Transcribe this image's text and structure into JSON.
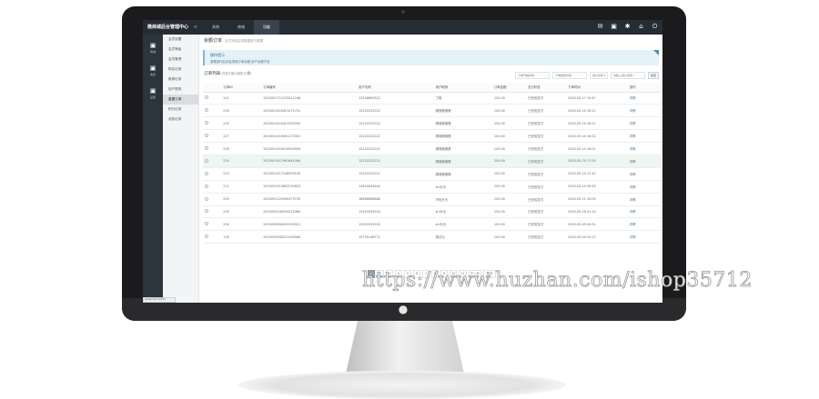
{
  "app": {
    "brand": "微商城后台管理中心",
    "brand_menu": "☰",
    "top_nav": [
      {
        "label": "系统",
        "active": false
      },
      {
        "label": "商城",
        "active": false
      },
      {
        "label": "功能",
        "active": true
      }
    ],
    "top_icons": [
      "message-icon",
      "profile-icon",
      "settings-icon",
      "home-icon",
      "power-icon"
    ]
  },
  "rail": [
    {
      "icon": "lock-icon",
      "label": "商城"
    },
    {
      "icon": "lock-icon",
      "label": "会员"
    },
    {
      "icon": "lock-icon",
      "label": "设置"
    }
  ],
  "sidebar": {
    "items": [
      {
        "label": "会员设置",
        "active": false
      },
      {
        "label": "会员等级",
        "active": false
      },
      {
        "label": "会员管理",
        "active": false
      },
      {
        "label": "购买记录",
        "active": false
      },
      {
        "label": "推荐记录",
        "active": false
      },
      {
        "label": "用户提现",
        "active": false
      },
      {
        "label": "重置订单",
        "active": true
      },
      {
        "label": "积分记录",
        "active": false
      },
      {
        "label": "消息记录",
        "active": false
      }
    ]
  },
  "page": {
    "title": "余额订单",
    "subtitle": "支付完成后将数据进行重置",
    "tip_title": "操作提示",
    "tip_body": "重置操作后将会清除订单余额,用户余额不变",
    "table_title": "订单列表",
    "table_subtitle": "(列表仅展示最新记录)",
    "filters": {
      "start_placeholder": "下单开始时间",
      "end_placeholder": "下单结束时间",
      "select_label": "用户名称 ▾",
      "keyword_placeholder": "请输入用户名称...",
      "search_label": "搜索"
    }
  },
  "table": {
    "columns": [
      "",
      "订单ID",
      "订单编号",
      "用户名称",
      "用户昵称",
      "订单金额",
      "支付状态",
      "下单时间",
      "操作"
    ],
    "rows": [
      {
        "id": "241",
        "no": "2020051712470011248",
        "user": "13336890322",
        "nick": "丁程",
        "amount": "100.00",
        "status": "已完成支付",
        "time": "2020-05-17 19:47",
        "op": "详情"
      },
      {
        "id": "233",
        "no": "2020051416421471731",
        "user": "15222222222",
        "nick": "顺德微微蛋",
        "amount": "100.00",
        "status": "已完成支付",
        "time": "2020-05-14 16:21",
        "op": "详情"
      },
      {
        "id": "232",
        "no": "2020051416421302005",
        "user": "15222222222",
        "nick": "顺德微微蛋",
        "amount": "100.00",
        "status": "已完成支付",
        "time": "2020-05-14 16:21",
        "op": "详情"
      },
      {
        "id": "227",
        "no": "2020051416091173302",
        "user": "15222222222",
        "nick": "顺德微微蛋",
        "amount": "100.00",
        "status": "已完成支付",
        "time": "2020-05-14 16:01",
        "op": "详情"
      },
      {
        "id": "226",
        "no": "2020051416010900004",
        "user": "15222222222",
        "nick": "顺德微微蛋",
        "amount": "100.00",
        "status": "已完成支付",
        "time": "2020-05-14 16:01",
        "op": "详情"
      },
      {
        "id": "224",
        "no": "2020051417991641564",
        "user": "15222222222",
        "nick": "顺德微微蛋",
        "amount": "200.00",
        "status": "已完成支付",
        "time": "2020-05-14 17:55",
        "op": "详情"
      },
      {
        "id": "219",
        "no": "2020051417248493155",
        "user": "15222222222",
        "nick": "顺德微微蛋",
        "amount": "100.00",
        "status": "已完成支付",
        "time": "2020-05-14 17:42",
        "op": "详情"
      },
      {
        "id": "211",
        "no": "2020051510852532625",
        "user": "13444444444",
        "nick": "shi头头",
        "amount": "100.00",
        "status": "已完成支付",
        "time": "2020-05-15 09:43",
        "op": "详情"
      },
      {
        "id": "209",
        "no": "2020051120090473735",
        "user": "18888888888",
        "nick": "不知头头",
        "amount": "100.00",
        "status": "已完成支付",
        "time": "2020-05-11 20:09",
        "op": "详情"
      },
      {
        "id": "205",
        "no": "2020050106254225389",
        "user": "13333333333",
        "nick": "shi头头",
        "amount": "100.00",
        "status": "已完成支付",
        "time": "2020-05-16 01:14",
        "op": "详情"
      },
      {
        "id": "204",
        "no": "2020050908252335521",
        "user": "13333333333",
        "nick": "shi头头",
        "amount": "100.00",
        "status": "已完成支付",
        "time": "2020-05-09 02:51",
        "op": "详情"
      },
      {
        "id": "135",
        "no": "2020050908221344584",
        "user": "15735148771",
        "nick": "测试元",
        "amount": "100.00",
        "status": "已完成支付",
        "time": "2020-05-09 02:12",
        "op": "详情"
      }
    ],
    "highlight_row": 5
  },
  "pager": {
    "pages": [
      "1",
      "2",
      "3",
      "4",
      "5",
      "6",
      "7",
      "8",
      "9",
      "10",
      "11"
    ],
    "active": "1",
    "next_label": "下一页",
    "last_label": "尾页"
  },
  "status_bar": "javascript:void(0)",
  "watermark": "https://www.huzhan.com/ishop35712",
  "colors": {
    "topbar": "#252c33",
    "rail": "#2c343c",
    "tip_bg": "#e4f1f7",
    "highlight": "#eef6ef"
  }
}
